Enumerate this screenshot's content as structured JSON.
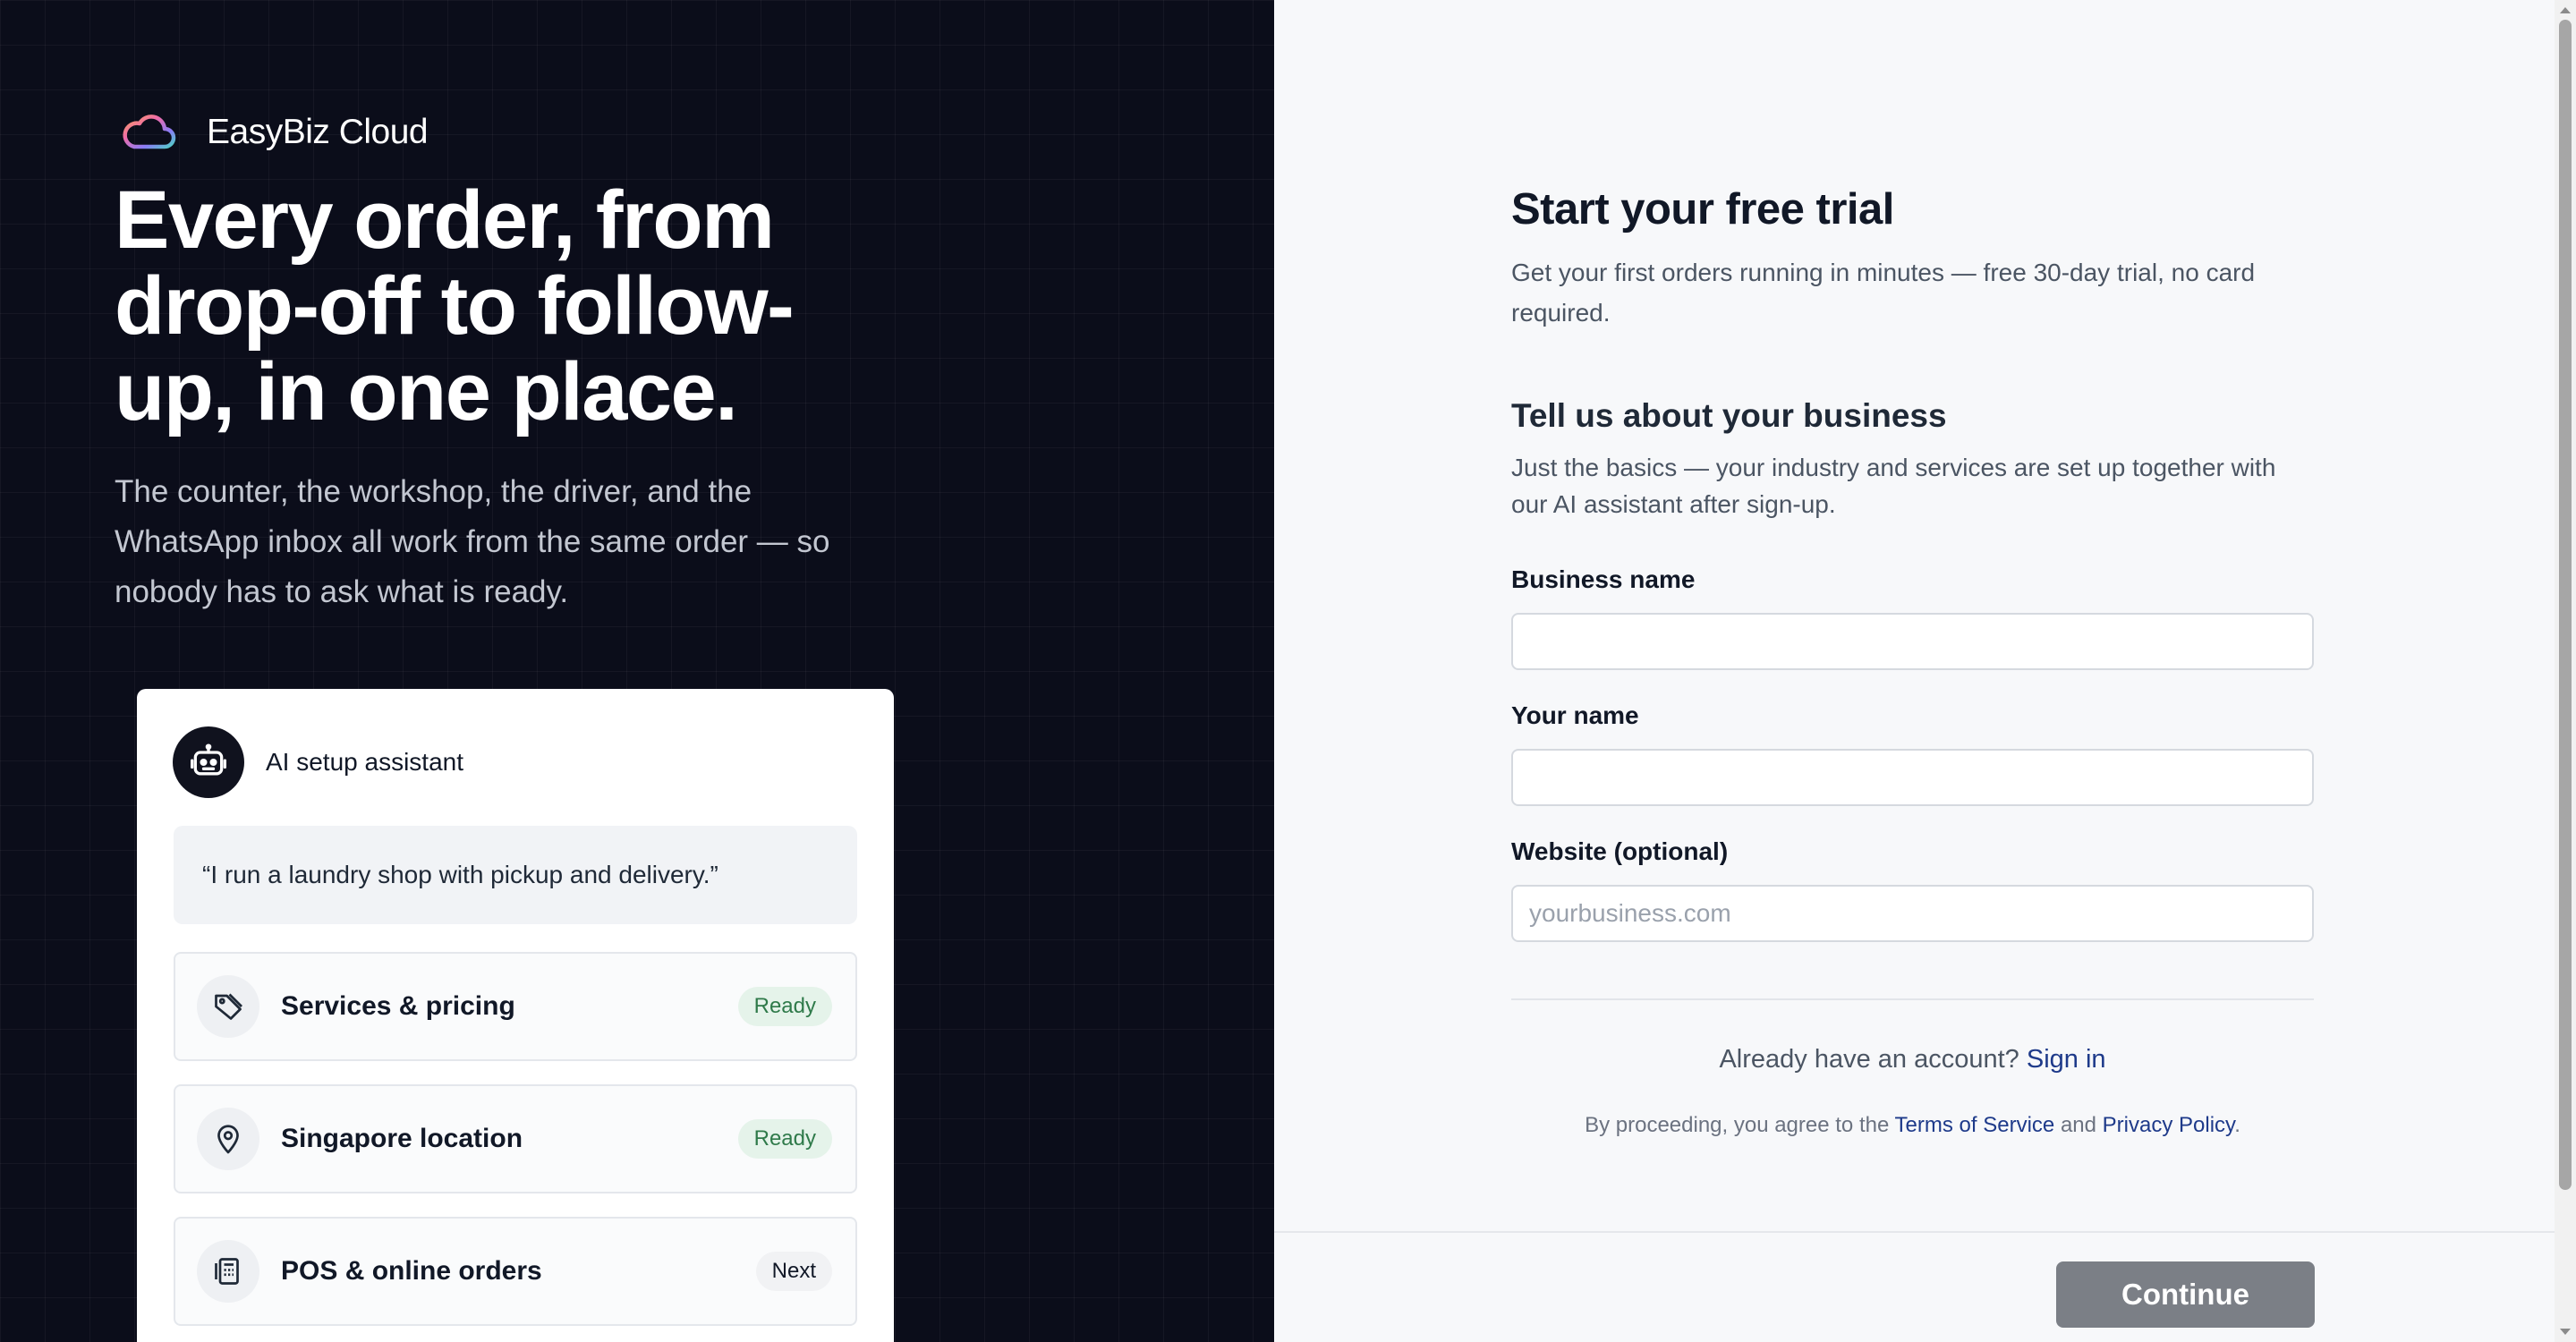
{
  "brand": {
    "name": "EasyBiz Cloud",
    "logo_icon": "cloud-gradient-icon"
  },
  "hero": {
    "title": "Every order, from drop-off to follow-up, in one place.",
    "subtitle": "The counter, the workshop, the driver, and the WhatsApp inbox all work from the same order — so nobody has to ask what is ready."
  },
  "assistant_card": {
    "title": "AI setup assistant",
    "avatar_icon": "robot-icon",
    "quote": "“I run a laundry shop with pickup and delivery.”",
    "steps": [
      {
        "label": "Services & pricing",
        "status": "Ready",
        "icon": "tag-icon"
      },
      {
        "label": "Singapore location",
        "status": "Ready",
        "icon": "map-pin-icon"
      },
      {
        "label": "POS & online orders",
        "status": "Next",
        "icon": "register-icon"
      }
    ]
  },
  "form": {
    "title": "Start your free trial",
    "subtitle": "Get your first orders running in minutes — free 30-day trial, no card required.",
    "section_title": "Tell us about your business",
    "section_subtitle": "Just the basics — your industry and services are set up together with our AI assistant after sign-up.",
    "fields": {
      "business_name": {
        "label": "Business name",
        "value": "",
        "placeholder": ""
      },
      "your_name": {
        "label": "Your name",
        "value": "",
        "placeholder": ""
      },
      "website": {
        "label": "Website (optional)",
        "value": "",
        "placeholder": "yourbusiness.com"
      }
    },
    "signin_prompt": "Already have an account?",
    "signin_link": "Sign in",
    "legal_prefix": "By proceeding, you agree to the",
    "terms_link": "Terms of Service",
    "legal_and": "and",
    "privacy_link": "Privacy Policy",
    "legal_suffix": ".",
    "continue_label": "Continue"
  },
  "colors": {
    "left_bg": "#0b0d1a",
    "right_bg": "#f7f8fa",
    "link": "#1e3a8a",
    "ready_badge_bg": "#e5f3ea",
    "ready_badge_text": "#2f7a4a",
    "continue_bg": "#7b7f86"
  }
}
